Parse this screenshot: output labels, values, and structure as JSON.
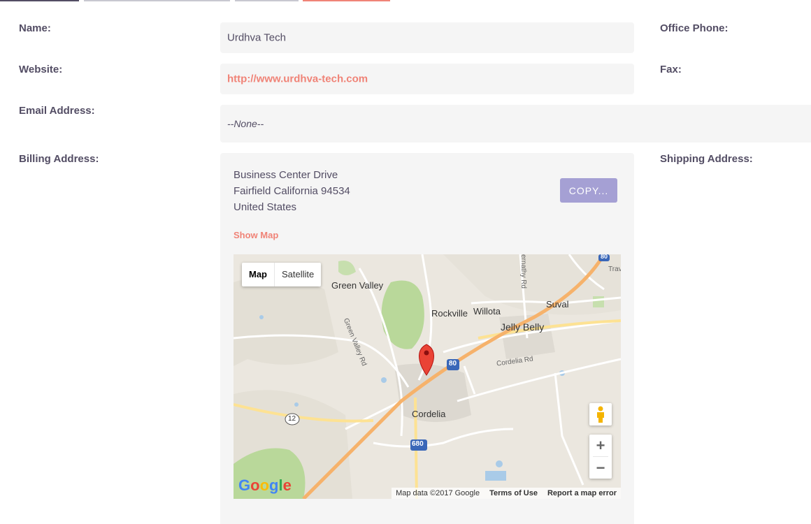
{
  "tabs": {
    "colors": [
      "#534d64",
      "#c8c8d0",
      "#c8c8d0",
      "#f08377"
    ]
  },
  "form": {
    "name_label": "Name:",
    "name_value": "Urdhva Tech",
    "website_label": "Website:",
    "website_value": "http://www.urdhva-tech.com",
    "email_label": "Email Address:",
    "email_value": "--None--",
    "billing_label": "Billing Address:",
    "office_phone_label": "Office Phone:",
    "fax_label": "Fax:",
    "shipping_label": "Shipping Address:"
  },
  "billing": {
    "street": "Business Center Drive",
    "city_line": "Fairfield California  94534",
    "country": "United States",
    "copy_label": "COPY...",
    "show_map_label": "Show Map"
  },
  "map": {
    "type_map": "Map",
    "type_satellite": "Satellite",
    "zoom_in": "+",
    "zoom_out": "−",
    "labels": {
      "green_valley": "Green Valley",
      "rockville": "Rockville",
      "willota": "Willota",
      "suval": "Suval",
      "jelly_belly": "Jelly Belly",
      "cordelia": "Cordelia",
      "cordelia_rd": "Cordelia Rd",
      "green_valley_rd": "Green Valley Rd",
      "abernathy_rd": "ernathy Rd",
      "trav": "Trav"
    },
    "shields": {
      "i80": "80",
      "i80b": "80",
      "i680": "680",
      "r12": "12"
    },
    "google": "Google",
    "attribution": "Map data ©2017 Google",
    "terms": "Terms of Use",
    "report": "Report a map error"
  }
}
